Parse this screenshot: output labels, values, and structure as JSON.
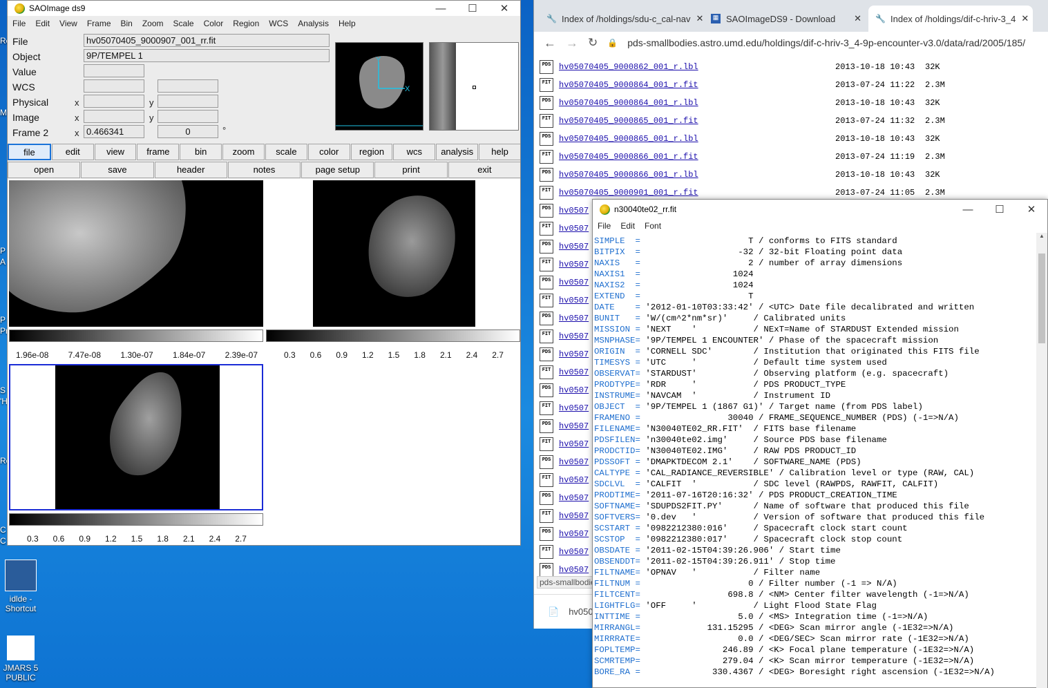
{
  "desktop": {
    "icons": [
      {
        "label": "idlde - Shortcut"
      },
      {
        "label": "JMARS 5 PUBLIC"
      }
    ],
    "fragments": [
      "Re",
      "M",
      "P",
      "A",
      "P",
      "Pri",
      "S",
      "'H",
      "Re",
      "C",
      "C"
    ]
  },
  "ds9": {
    "title": "SAOImage ds9",
    "menu": [
      "File",
      "Edit",
      "View",
      "Frame",
      "Bin",
      "Zoom",
      "Scale",
      "Color",
      "Region",
      "WCS",
      "Analysis",
      "Help"
    ],
    "info": {
      "file_label": "File",
      "file_value": "hv05070405_9000907_001_rr.fit",
      "object_label": "Object",
      "object_value": "9P/TEMPEL 1",
      "value_label": "Value",
      "wcs_label": "WCS",
      "physical_label": "Physical",
      "image_label": "Image",
      "frame_label": "Frame 2",
      "frame_x": "0.466341",
      "frame_y": "0",
      "x_label": "x",
      "y_label": "y",
      "deg": "°"
    },
    "thumb_axes": {
      "x": "X",
      "y": "Y"
    },
    "buttons_top": [
      "file",
      "edit",
      "view",
      "frame",
      "bin",
      "zoom",
      "scale",
      "color",
      "region",
      "wcs",
      "analysis",
      "help"
    ],
    "buttons_bottom": [
      "open",
      "save",
      "header",
      "notes",
      "page setup",
      "print",
      "exit"
    ],
    "colorbar1": [
      "1.96e-08",
      "7.47e-08",
      "1.30e-07",
      "1.84e-07",
      "2.39e-07"
    ],
    "colorbar2": [
      "0.3",
      "0.6",
      "0.9",
      "1.2",
      "1.5",
      "1.8",
      "2.1",
      "2.4",
      "2.7"
    ],
    "colorbar3": [
      "0.3",
      "0.6",
      "0.9",
      "1.2",
      "1.5",
      "1.8",
      "2.1",
      "2.4",
      "2.7"
    ]
  },
  "browser": {
    "tabs": [
      {
        "title": "Index of /holdings/sdu-c_cal-nav",
        "active": false
      },
      {
        "title": "SAOImageDS9 - Download",
        "active": false
      },
      {
        "title": "Index of /holdings/dif-c-hriv-3_4",
        "active": true
      }
    ],
    "url": "pds-smallbodies.astro.umd.edu/holdings/dif-c-hriv-3_4-9p-encounter-v3.0/data/rad/2005/185/",
    "rows": [
      {
        "type": "PDS",
        "name": "hv05070405_9000862_001_r.lbl",
        "date": "2013-10-18 10:43",
        "size": "32K"
      },
      {
        "type": "FIT",
        "name": "hv05070405_9000864_001_r.fit",
        "date": "2013-07-24 11:22",
        "size": "2.3M"
      },
      {
        "type": "PDS",
        "name": "hv05070405_9000864_001_r.lbl",
        "date": "2013-10-18 10:43",
        "size": "32K"
      },
      {
        "type": "FIT",
        "name": "hv05070405_9000865_001_r.fit",
        "date": "2013-07-24 11:32",
        "size": "2.3M"
      },
      {
        "type": "PDS",
        "name": "hv05070405_9000865_001_r.lbl",
        "date": "2013-10-18 10:43",
        "size": "32K"
      },
      {
        "type": "FIT",
        "name": "hv05070405_9000866_001_r.fit",
        "date": "2013-07-24 11:19",
        "size": "2.3M"
      },
      {
        "type": "PDS",
        "name": "hv05070405_9000866_001_r.lbl",
        "date": "2013-10-18 10:43",
        "size": "32K"
      },
      {
        "type": "FIT",
        "name": "hv05070405_9000901_001_r.fit",
        "date": "2013-07-24 11:05",
        "size": "2.3M"
      },
      {
        "type": "PDS",
        "name": "hv0507",
        "date": "",
        "size": ""
      },
      {
        "type": "FIT",
        "name": "hv0507",
        "date": "",
        "size": ""
      },
      {
        "type": "PDS",
        "name": "hv0507",
        "date": "",
        "size": ""
      },
      {
        "type": "FIT",
        "name": "hv0507",
        "date": "",
        "size": ""
      },
      {
        "type": "PDS",
        "name": "hv0507",
        "date": "",
        "size": ""
      },
      {
        "type": "FIT",
        "name": "hv0507",
        "date": "",
        "size": ""
      },
      {
        "type": "PDS",
        "name": "hv0507",
        "date": "",
        "size": ""
      },
      {
        "type": "FIT",
        "name": "hv0507",
        "date": "",
        "size": ""
      },
      {
        "type": "PDS",
        "name": "hv0507",
        "date": "",
        "size": ""
      },
      {
        "type": "FIT",
        "name": "hv0507",
        "date": "",
        "size": ""
      },
      {
        "type": "PDS",
        "name": "hv0507",
        "date": "",
        "size": ""
      },
      {
        "type": "FIT",
        "name": "hv0507",
        "date": "",
        "size": ""
      },
      {
        "type": "PDS",
        "name": "hv0507",
        "date": "",
        "size": ""
      },
      {
        "type": "FIT",
        "name": "hv0507",
        "date": "",
        "size": ""
      },
      {
        "type": "PDS",
        "name": "hv0507",
        "date": "",
        "size": ""
      },
      {
        "type": "FIT",
        "name": "hv0507",
        "date": "",
        "size": ""
      },
      {
        "type": "PDS",
        "name": "hv0507",
        "date": "",
        "size": ""
      },
      {
        "type": "FIT",
        "name": "hv0507",
        "date": "",
        "size": ""
      },
      {
        "type": "PDS",
        "name": "hv0507",
        "date": "",
        "size": ""
      },
      {
        "type": "FIT",
        "name": "hv0507",
        "date": "",
        "size": ""
      },
      {
        "type": "PDS",
        "name": "hv0507",
        "date": "",
        "size": ""
      }
    ],
    "status": "pds-smallbodie",
    "download_text": "hv050"
  },
  "fits": {
    "title": "n30040te02_rr.fit",
    "menu": [
      "File",
      "Edit",
      "Font"
    ],
    "lines": [
      [
        "SIMPLE  =",
        "                    T / conforms to FITS standard"
      ],
      [
        "BITPIX  =",
        "                  -32 / 32-bit Floating point data"
      ],
      [
        "NAXIS   =",
        "                    2 / number of array dimensions"
      ],
      [
        "NAXIS1  =",
        "                 1024"
      ],
      [
        "NAXIS2  =",
        "                 1024"
      ],
      [
        "EXTEND  =",
        "                    T"
      ],
      [
        "DATE    =",
        "'2012-01-10T03:33:42' / <UTC> Date file decalibrated and written"
      ],
      [
        "BUNIT   =",
        "'W/(cm^2*nm*sr)'     / Calibrated units"
      ],
      [
        "MISSION =",
        "'NEXT    '           / NExT=Name of STARDUST Extended mission"
      ],
      [
        "MSNPHASE=",
        "'9P/TEMPEL 1 ENCOUNTER' / Phase of the spacecraft mission"
      ],
      [
        "ORIGIN  =",
        "'CORNELL SDC'        / Institution that originated this FITS file"
      ],
      [
        "TIMESYS =",
        "'UTC     '           / Default time system used"
      ],
      [
        "OBSERVAT=",
        "'STARDUST'           / Observing platform (e.g. spacecraft)"
      ],
      [
        "PRODTYPE=",
        "'RDR     '           / PDS PRODUCT_TYPE"
      ],
      [
        "INSTRUME=",
        "'NAVCAM  '           / Instrument ID"
      ],
      [
        "OBJECT  =",
        "'9P/TEMPEL 1 (1867 G1)' / Target name (from PDS label)"
      ],
      [
        "FRAMENO =",
        "                30040 / FRAME_SEQUENCE_NUMBER (PDS) (-1=>N/A)"
      ],
      [
        "FILENAME=",
        "'N30040TE02_RR.FIT'  / FITS base filename"
      ],
      [
        "PDSFILEN=",
        "'n30040te02.img'     / Source PDS base filename"
      ],
      [
        "PRODCTID=",
        "'N30040TE02.IMG'     / RAW PDS PRODUCT_ID"
      ],
      [
        "PDSSOFT =",
        "'DMAPKTDECOM 2.1'    / SOFTWARE_NAME (PDS)"
      ],
      [
        "CALTYPE =",
        "'CAL_RADIANCE_REVERSIBLE' / Calibration level or type (RAW, CAL)"
      ],
      [
        "SDCLVL  =",
        "'CALFIT  '           / SDC level (RAWPDS, RAWFIT, CALFIT)"
      ],
      [
        "PRODTIME=",
        "'2011-07-16T20:16:32' / PDS PRODUCT_CREATION_TIME"
      ],
      [
        "SOFTNAME=",
        "'SDUPDS2FIT.PY'      / Name of software that produced this file"
      ],
      [
        "SOFTVERS=",
        "'0.dev   '           / Version of software that produced this file"
      ],
      [
        "SCSTART =",
        "'0982212380:016'     / Spacecraft clock start count"
      ],
      [
        "SCSTOP  =",
        "'0982212380:017'     / Spacecraft clock stop count"
      ],
      [
        "OBSDATE =",
        "'2011-02-15T04:39:26.906' / Start time"
      ],
      [
        "OBSENDDT=",
        "'2011-02-15T04:39:26.911' / Stop time"
      ],
      [
        "FILTNAME=",
        "'OPNAV   '           / Filter name"
      ],
      [
        "FILTNUM =",
        "                    0 / Filter number (-1 => N/A)"
      ],
      [
        "FILTCENT=",
        "                698.8 / <NM> Center filter wavelength (-1=>N/A)"
      ],
      [
        "LIGHTFLG=",
        "'OFF     '           / Light Flood State Flag"
      ],
      [
        "INTTIME =",
        "                  5.0 / <MS> Integration time (-1=>N/A)"
      ],
      [
        "MIRRANGL=",
        "            131.15295 / <DEG> Scan mirror angle (-1E32=>N/A)"
      ],
      [
        "MIRRRATE=",
        "                  0.0 / <DEG/SEC> Scan mirror rate (-1E32=>N/A)"
      ],
      [
        "FOPLTEMP=",
        "               246.89 / <K> Focal plane temperature (-1E32=>N/A)"
      ],
      [
        "SCMRTEMP=",
        "               279.04 / <K> Scan mirror temperature (-1E32=>N/A)"
      ],
      [
        "BORE_RA =",
        "             330.4367 / <DEG> Boresight right ascension (-1E32=>N/A)"
      ]
    ]
  }
}
